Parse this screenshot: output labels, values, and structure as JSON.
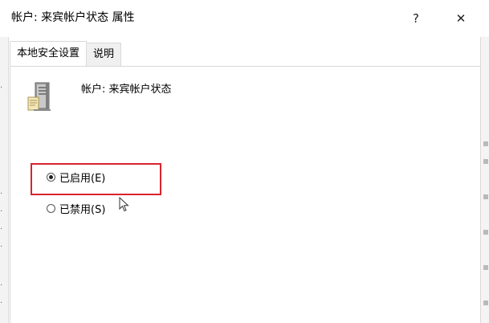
{
  "window": {
    "title": "帐户: 来宾帐户状态 属性",
    "help_glyph": "?",
    "close_glyph": "✕"
  },
  "tabs": [
    {
      "label": "本地安全设置",
      "active": true
    },
    {
      "label": "说明",
      "active": false
    }
  ],
  "policy": {
    "icon": "server-icon",
    "name": "帐户: 来宾帐户状态"
  },
  "options": {
    "enabled": {
      "label": "已启用(E)",
      "checked": true
    },
    "disabled": {
      "label": "已禁用(S)",
      "checked": false
    }
  },
  "highlight_color": "#d9232e"
}
